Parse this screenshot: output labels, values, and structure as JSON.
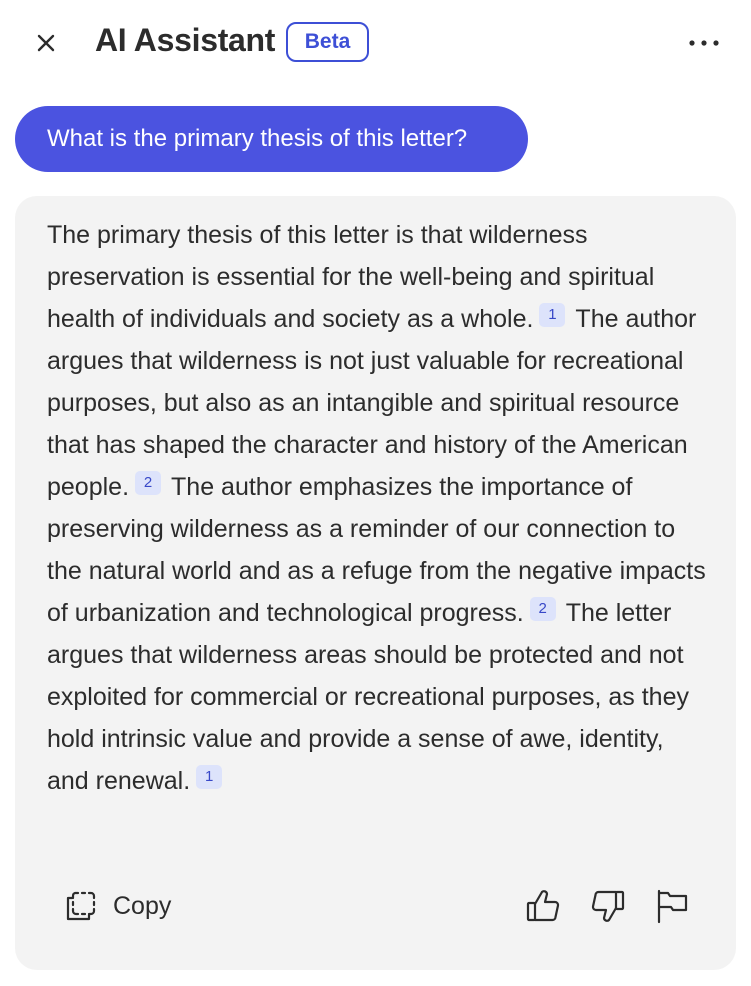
{
  "header": {
    "close_icon": "close-icon",
    "title": "AI Assistant",
    "badge": "Beta",
    "more_icon": "more-options-icon"
  },
  "conversation": {
    "user_question": "What is the primary thesis of this letter?",
    "answer": {
      "segments": [
        {
          "text": "The primary thesis of this letter is that wilderness preservation is essential for the well-being and spiritual health of individuals and society as a whole.",
          "citation": "1"
        },
        {
          "text": "The author argues that wilderness is not just valuable for recreational purposes, but also as an intangible and spiritual resource that has shaped the character and history of the American people.",
          "citation": "2"
        },
        {
          "text": "The author emphasizes the importance of preserving wilderness as a reminder of our connection to the natural world and as a refuge from the negative impacts of urbanization and technological progress.",
          "citation": "2"
        },
        {
          "text": "The letter argues that wilderness areas should be protected and not exploited for commercial or recreational purposes, as they hold intrinsic value and provide a sense of awe, identity, and renewal.",
          "citation": "1"
        }
      ]
    },
    "actions": {
      "copy_label": "Copy",
      "copy_icon": "copy-icon",
      "thumbs_up_icon": "thumbs-up-icon",
      "thumbs_down_icon": "thumbs-down-icon",
      "flag_icon": "flag-icon"
    }
  },
  "colors": {
    "accent": "#4b53e0",
    "badge": "#3d4fd6",
    "citation_bg": "#dde3fb",
    "card_bg": "#f3f3f3"
  }
}
